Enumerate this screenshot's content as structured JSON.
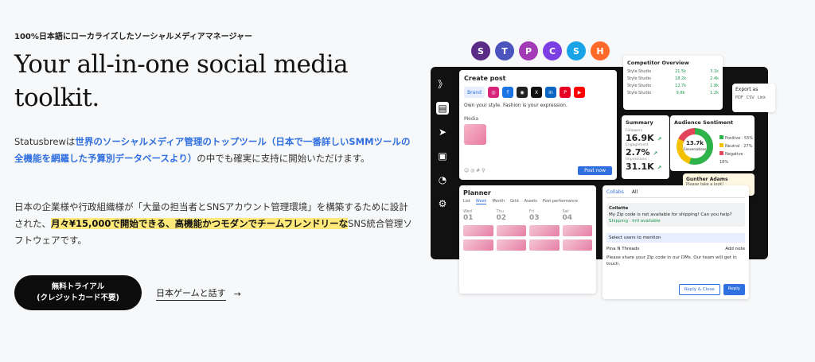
{
  "hero": {
    "eyebrow": "100%日本語にローカライズしたソーシャルメディアマネージャー",
    "headline": "Your all-in-one social media toolkit.",
    "p1_pre": "Statusbrewは",
    "p1_highlight": "世界のソーシャルメディア管理のトップツール（日本で一番詳しいSMMツールの全機能を網羅した予算別データベースより）",
    "p1_post": "の中でも確実に支持に開始いただけます。",
    "p2_pre": "日本の企業様や行政組織様が「大量の担当者とSNSアカウント管理環境」を構築するために設計された、",
    "p2_highlight": "月々¥15,000で開始できる、高機能かつモダンでチームフレンドリーな",
    "p2_post": "SNS統合管理ソフトウェアです。",
    "cta_line1": "無料トライアル",
    "cta_line2": "(クレジットカード不要)",
    "demo_label": "日本ゲームと話す",
    "demo_arrow": "→"
  },
  "app": {
    "integrations": [
      "S",
      "T",
      "P",
      "C",
      "S",
      "H"
    ],
    "integration_colors": [
      "#5b2a86",
      "#4b53bc",
      "#a23bb5",
      "#7b3fe4",
      "#1aa4e8",
      "#ff6a2b"
    ],
    "rail": [
      "》",
      "▤",
      "➤",
      "▣",
      "◔",
      "⚙"
    ],
    "create_post": {
      "title": "Create post",
      "networks": [
        "Brand",
        "◎",
        "f",
        "◉",
        "X",
        "in",
        "P",
        "▶"
      ],
      "caption": "Own your style. Fashion is your expression.",
      "media_label": "Media",
      "post_button": "Post now"
    },
    "competitor": {
      "title": "Competitor Overview",
      "rows": [
        {
          "name": "Style Studio",
          "a": "21.5k",
          "b": "3.1k"
        },
        {
          "name": "Style Studio",
          "a": "18.2k",
          "b": "2.4k"
        },
        {
          "name": "Style Studio",
          "a": "12.7k",
          "b": "1.9k"
        },
        {
          "name": "Style Studio",
          "a": "9.8k",
          "b": "1.2k"
        }
      ]
    },
    "export": {
      "title": "Export as",
      "items": [
        "PDF",
        "CSV",
        "Link"
      ]
    },
    "summary": {
      "title": "Summary",
      "items": [
        {
          "label": "Followers",
          "value": "16.9K"
        },
        {
          "label": "Engagement",
          "value": "2.7%"
        },
        {
          "label": "Impressions",
          "value": "31.1K"
        }
      ]
    },
    "audience": {
      "title": "Audience Sentiment",
      "center_value": "13.7k",
      "center_label": "Conversations",
      "legend": [
        {
          "label": "Positive · 55%",
          "color": "#2db34a"
        },
        {
          "label": "Neutral · 27%",
          "color": "#f2c200"
        },
        {
          "label": "Negative · 18%",
          "color": "#e2455a"
        }
      ]
    },
    "gunther": {
      "name": "Gunther Adams",
      "note": "Please take a look!"
    },
    "planner": {
      "title": "Planner",
      "tabs": [
        "List",
        "Week",
        "Month",
        "Grid",
        "Assets",
        "Post performance"
      ],
      "active_tab": "Week",
      "days": [
        {
          "name": "Wed",
          "num": "01"
        },
        {
          "name": "Thu",
          "num": "02"
        },
        {
          "name": "Fri",
          "num": "03"
        },
        {
          "name": "Sat",
          "num": "04"
        }
      ]
    },
    "inbox": {
      "tabs": [
        "Collabs",
        "All"
      ],
      "sender": "Collette",
      "message": "My Zip code is not available for shipping! Can you help?",
      "tags": "Shipping · Intl available",
      "mention_label": "Select users to mention",
      "assignee": "Pina N Threads",
      "add_note": "Add note",
      "reply_text": "Please share your Zip code in our DMs. Our team will get in touch.",
      "reply_close": "Reply & Close",
      "reply": "Reply"
    }
  }
}
